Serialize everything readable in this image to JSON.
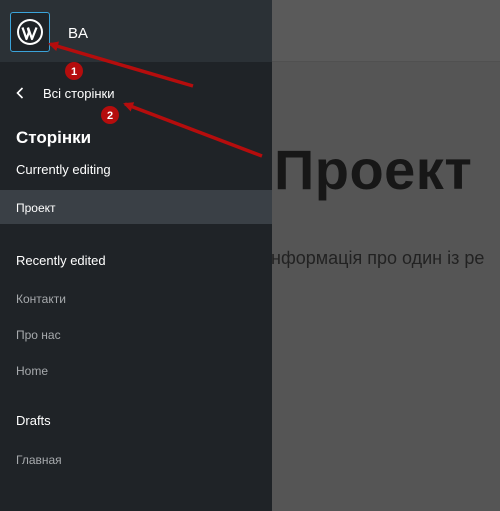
{
  "site": {
    "name": "BA",
    "logo_icon": "wordpress-logo-icon"
  },
  "nav": {
    "back_label": "Всі сторінки",
    "back_icon": "chevron-left-icon"
  },
  "section": {
    "title": "Сторінки"
  },
  "groups": {
    "currently_editing": {
      "label": "Currently editing",
      "items": [
        "Проект"
      ]
    },
    "recently_edited": {
      "label": "Recently edited",
      "items": [
        "Контакти",
        "Про нас",
        "Home"
      ]
    },
    "drafts": {
      "label": "Drafts",
      "items": [
        "Главная"
      ]
    }
  },
  "canvas": {
    "title": "Проект",
    "text": "Інформація про один із ре"
  },
  "annotations": [
    {
      "label": "1"
    },
    {
      "label": "2"
    }
  ],
  "colors": {
    "sidebar_bg": "#1f2327",
    "header_bg": "#2b3136",
    "selected_bg": "#3a4046",
    "accent": "#3ba3d9",
    "marker_red": "#b50d0d"
  }
}
